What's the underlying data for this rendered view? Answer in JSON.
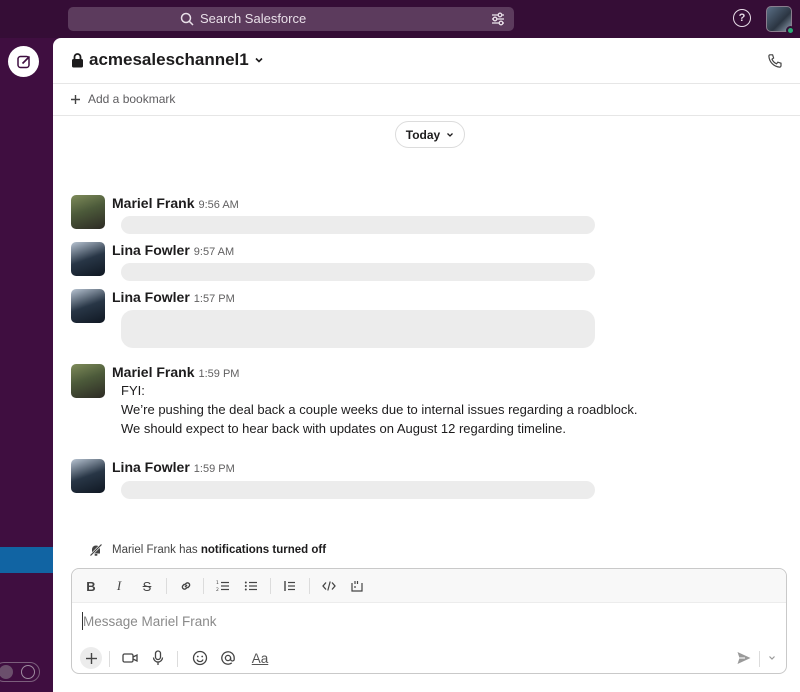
{
  "topbar": {
    "search_placeholder": "Search Salesforce",
    "help_symbol": "?"
  },
  "channel": {
    "name": "acmesaleschannel1",
    "bookmark_label": "Add a bookmark"
  },
  "date_divider": "Today",
  "messages": [
    {
      "sender": "Mariel Frank",
      "time": "9:56 AM",
      "lines": []
    },
    {
      "sender": "Lina Fowler",
      "time": "9:57 AM",
      "lines": []
    },
    {
      "sender": "Lina Fowler",
      "time": "1:57 PM",
      "lines": []
    },
    {
      "sender": "Mariel Frank",
      "time": "1:59 PM",
      "lines": [
        "FYI:",
        "We’re pushing the deal back a couple weeks due to internal issues regarding a roadblock.",
        "We should expect to hear back with updates on August 12 regarding timeline."
      ]
    },
    {
      "sender": "Lina Fowler",
      "time": "1:59 PM",
      "lines": []
    }
  ],
  "notification": {
    "name": "Mariel Frank",
    "middle": " has ",
    "status": "notifications turned off"
  },
  "composer": {
    "placeholder": "Message Mariel Frank",
    "format_bold": "B",
    "format_italic": "I",
    "format_strike": "S",
    "text_format_label": "Aa"
  },
  "colors": {
    "topbar": "#350d36",
    "sidebar": "#3f0e40",
    "sidebar_active": "#1164a3",
    "presence": "#2bac76"
  }
}
